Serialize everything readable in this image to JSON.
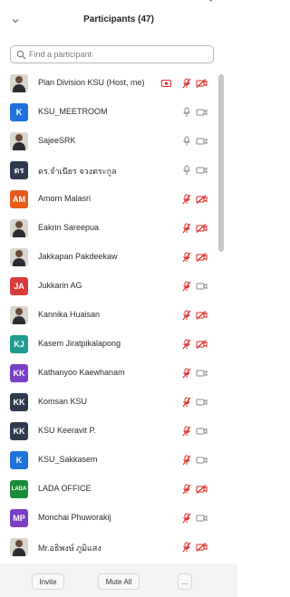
{
  "header": {
    "title": "Participants (47)"
  },
  "search": {
    "placeholder": "Find a participant"
  },
  "participants": [
    {
      "name": "Plan Division KSU (Host, me)",
      "avatar_type": "photo",
      "avatar_color": "#d9d4cc",
      "mic": "muted",
      "video": "off",
      "screen_share": true
    },
    {
      "name": "KSU_MEETROOM",
      "avatar_initials": "K",
      "avatar_type": "initials",
      "avatar_color": "#1e72d9",
      "mic": "on",
      "video": "on"
    },
    {
      "name": "SajeeSRK",
      "avatar_type": "photo",
      "avatar_color": "#d9d4cc",
      "mic": "on",
      "video": "on"
    },
    {
      "name": "ดร.จำเนียร จวงตระกูล",
      "avatar_initials": "ดร",
      "avatar_type": "initials",
      "avatar_color": "#2f3a4f",
      "mic": "on",
      "video": "on"
    },
    {
      "name": "Amorn Malasri",
      "avatar_initials": "AM",
      "avatar_type": "initials",
      "avatar_color": "#e85a1c",
      "mic": "muted",
      "video": "off"
    },
    {
      "name": "Eakrin Sareepua",
      "avatar_type": "photo",
      "avatar_color": "#d9d4cc",
      "mic": "muted",
      "video": "off"
    },
    {
      "name": "Jakkapan Pakdeekaw",
      "avatar_type": "photo",
      "avatar_color": "#d9d4cc",
      "mic": "muted",
      "video": "off"
    },
    {
      "name": "Jukkarin AG",
      "avatar_initials": "JA",
      "avatar_type": "initials",
      "avatar_color": "#d83b3b",
      "mic": "muted",
      "video": "on"
    },
    {
      "name": "Kannika  Huaisan",
      "avatar_type": "photo",
      "avatar_color": "#d9d4cc",
      "mic": "muted",
      "video": "off"
    },
    {
      "name": "Kasem Jiratpikalapong",
      "avatar_initials": "KJ",
      "avatar_type": "initials",
      "avatar_color": "#1f9b8f",
      "mic": "muted",
      "video": "off"
    },
    {
      "name": "Kathanyoo Kaewhanam",
      "avatar_initials": "KK",
      "avatar_type": "initials",
      "avatar_color": "#7b3fc4",
      "mic": "muted",
      "video": "on"
    },
    {
      "name": "Komsan KSU",
      "avatar_initials": "KK",
      "avatar_type": "initials",
      "avatar_color": "#2f3a4f",
      "mic": "muted",
      "video": "on"
    },
    {
      "name": "KSU Keeravit P.",
      "avatar_initials": "KK",
      "avatar_type": "initials",
      "avatar_color": "#2f3a4f",
      "mic": "muted",
      "video": "on"
    },
    {
      "name": "KSU_Sakkasem",
      "avatar_initials": "K",
      "avatar_type": "initials",
      "avatar_color": "#1e72d9",
      "mic": "muted",
      "video": "on"
    },
    {
      "name": "LADA OFFICE",
      "avatar_initials": "LADA",
      "avatar_type": "initials",
      "avatar_color": "#1d8a3a",
      "mic": "muted",
      "video": "off"
    },
    {
      "name": "Monchai Phuworakij",
      "avatar_initials": "MP",
      "avatar_type": "initials",
      "avatar_color": "#7b3fc4",
      "mic": "muted",
      "video": "on"
    },
    {
      "name": "Mr.อธิพงษ์ ภูมิแสง",
      "avatar_type": "photo",
      "avatar_color": "#d9d4cc",
      "mic": "muted",
      "video": "off"
    }
  ],
  "footer": {
    "invite_label": "Invite",
    "mute_all_label": "Mute All",
    "more_label": "..."
  },
  "colors": {
    "muted_red": "#e02828",
    "icon_gray": "#8a8a92",
    "scrollbar": "#c7c7cc",
    "footer_bg": "#f3f3f5"
  },
  "icons": {
    "collapse": "chevron-down-icon",
    "search": "search-icon",
    "mic_on": "microphone-icon",
    "mic_muted": "microphone-muted-icon",
    "video_on": "video-camera-icon",
    "video_off": "video-camera-off-icon",
    "share": "screen-share-icon"
  }
}
